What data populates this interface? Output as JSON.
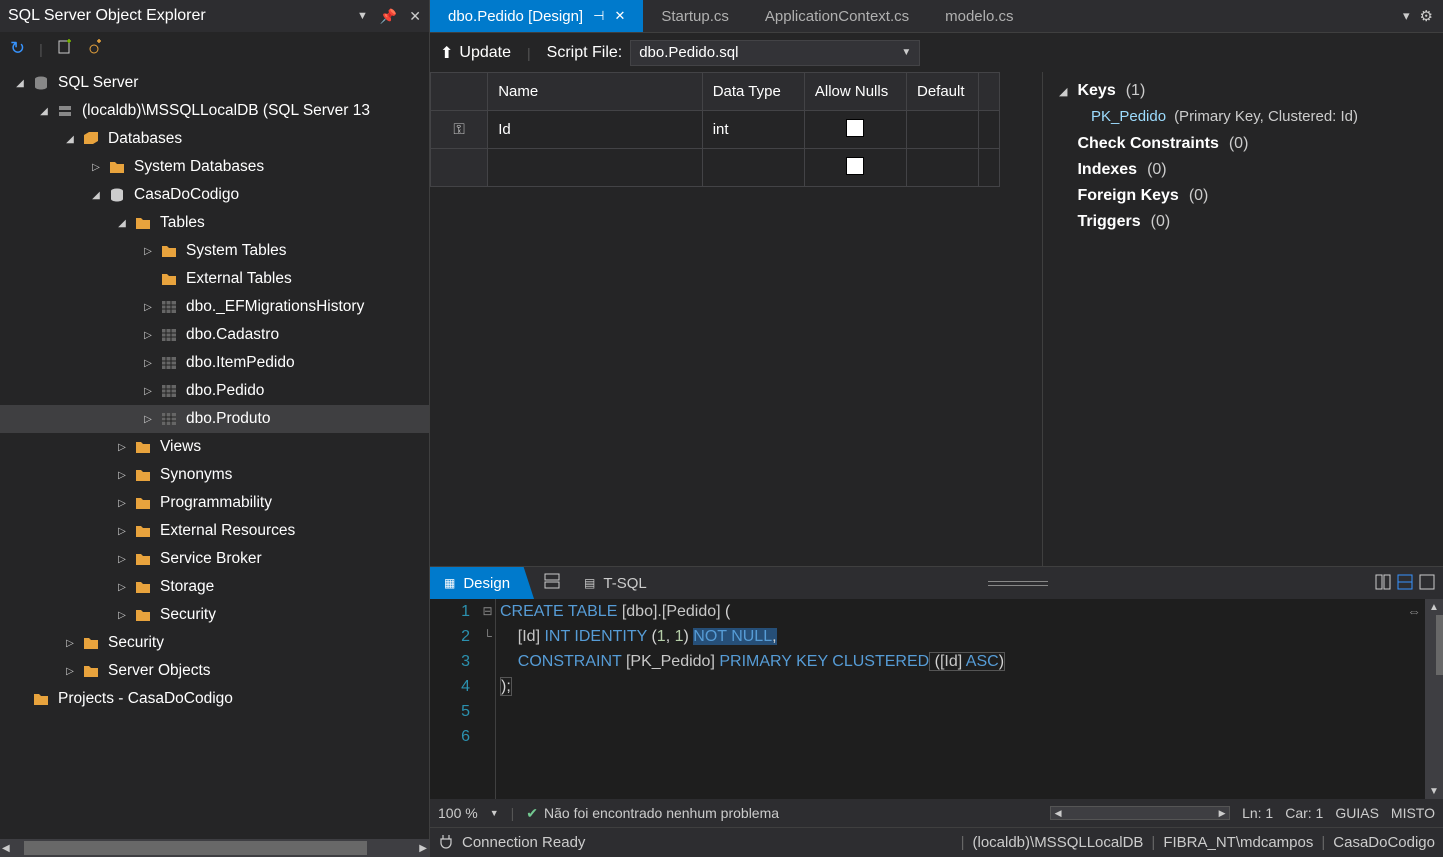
{
  "explorer": {
    "title": "SQL Server Object Explorer",
    "tree": {
      "root": "SQL Server",
      "server": "(localdb)\\MSSQLLocalDB (SQL Server 13",
      "databases": "Databases",
      "sysdb": "System Databases",
      "db": "CasaDoCodigo",
      "tables": "Tables",
      "systables": "System Tables",
      "exttables": "External Tables",
      "t1": "dbo._EFMigrationsHistory",
      "t2": "dbo.Cadastro",
      "t3": "dbo.ItemPedido",
      "t4": "dbo.Pedido",
      "t5": "dbo.Produto",
      "views": "Views",
      "synonyms": "Synonyms",
      "prog": "Programmability",
      "extres": "External Resources",
      "sb": "Service Broker",
      "storage": "Storage",
      "security": "Security",
      "serversec": "Security",
      "serverobj": "Server Objects",
      "projects": "Projects - CasaDoCodigo"
    }
  },
  "tabs": {
    "active": "dbo.Pedido [Design]",
    "t2": "Startup.cs",
    "t3": "ApplicationContext.cs",
    "t4": "modelo.cs"
  },
  "update_bar": {
    "update": "Update",
    "script_label": "Script File:",
    "script_value": "dbo.Pedido.sql"
  },
  "grid": {
    "hdr_name": "Name",
    "hdr_type": "Data Type",
    "hdr_nulls": "Allow Nulls",
    "hdr_default": "Default",
    "cell_name": "Id",
    "cell_type": "int"
  },
  "props": {
    "keys": "Keys",
    "keys_count": "(1)",
    "pk": "PK_Pedido",
    "pk_detail": "(Primary Key, Clustered: Id)",
    "cc": "Check Constraints",
    "cc_count": "(0)",
    "idx": "Indexes",
    "idx_count": "(0)",
    "fk": "Foreign Keys",
    "fk_count": "(0)",
    "trg": "Triggers",
    "trg_count": "(0)"
  },
  "code_tabs": {
    "design": "Design",
    "tsql": "T-SQL"
  },
  "sql": {
    "l1_a": "CREATE",
    "l1_b": "TABLE",
    "l1_c": "[dbo]",
    "l1_d": ".",
    "l1_e": "[Pedido]",
    "l1_f": " (",
    "l2_a": "    ",
    "l2_b": "[Id]",
    "l2_c": " INT",
    "l2_d": " IDENTITY",
    "l2_e": " (",
    "l2_f": "1",
    "l2_g": ", ",
    "l2_h": "1",
    "l2_i": ") ",
    "l2_j": "NOT",
    "l2_k": " NULL",
    "l2_l": ",",
    "l3_a": "    ",
    "l3_b": "CONSTRAINT",
    "l3_c": " [PK_Pedido]",
    "l3_d": " PRIMARY",
    "l3_e": " KEY",
    "l3_f": " CLUSTERED",
    "l3_g": " (",
    "l3_h": "[Id]",
    "l3_i": " ASC",
    "l3_j": ")",
    "l4_a": ");"
  },
  "zoom_bar": {
    "zoom": "100 %",
    "noissue": "Não foi encontrado nenhum problema",
    "ln": "Ln: 1",
    "car": "Car: 1",
    "guias": "GUIAS",
    "misto": "MISTO"
  },
  "status": {
    "ready": "Connection Ready",
    "server": "(localdb)\\MSSQLLocalDB",
    "user": "FIBRA_NT\\mdcampos",
    "db": "CasaDoCodigo"
  }
}
